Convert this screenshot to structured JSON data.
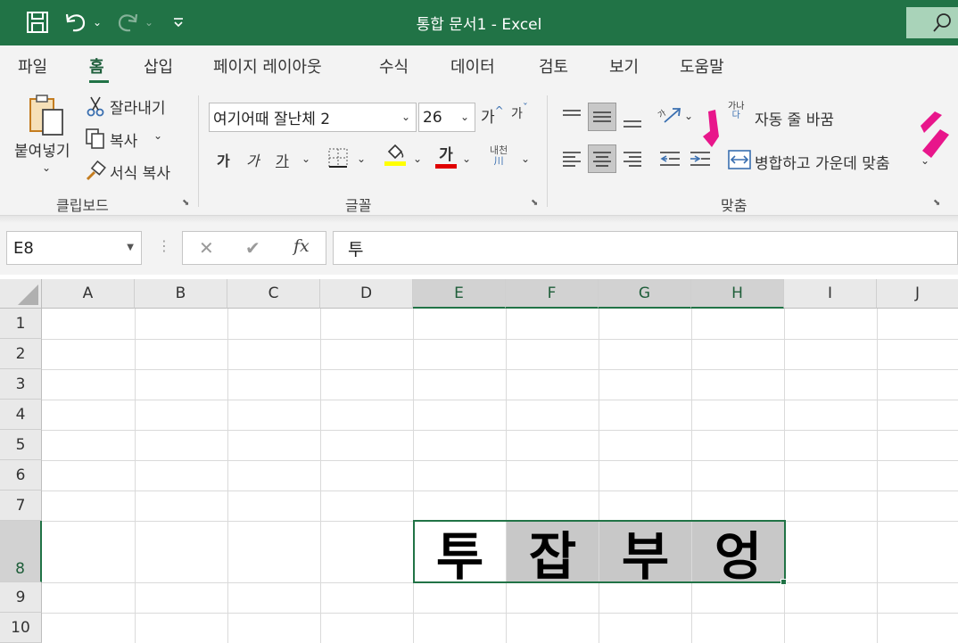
{
  "window": {
    "title": "통합 문서1  -  Excel"
  },
  "tabs": [
    "파일",
    "홈",
    "삽입",
    "페이지 레이아웃",
    "수식",
    "데이터",
    "검토",
    "보기",
    "도움말"
  ],
  "active_tab": "홈",
  "ribbon": {
    "clipboard": {
      "paste_label": "붙여넣기",
      "cut_label": "잘라내기",
      "copy_label": "복사",
      "format_painter_label": "서식 복사",
      "group_label": "클립보드"
    },
    "font": {
      "font_name": "여기어때 잘난체 2",
      "font_size": "26",
      "grow_label": "가",
      "shrink_label": "가",
      "bold_label": "가",
      "italic_label": "가",
      "underline_label": "가",
      "font_color_label": "가",
      "phonetic_top": "내천",
      "phonetic_bottom": "川",
      "group_label": "글꼴",
      "highlight_color": "#ffff00",
      "font_color": "#e00000"
    },
    "alignment": {
      "orientation_label": "가",
      "wrap_text_icon_top": "가나",
      "wrap_text_icon_bottom": "다",
      "wrap_text_label": "자동 줄 바꿈",
      "merge_center_label": "병합하고 가운데 맞춤",
      "group_label": "맞춤",
      "top_selected": "middle",
      "horizontal_selected": "center"
    }
  },
  "formula_bar": {
    "name_box": "E8",
    "cancel_icon": "✕",
    "enter_icon": "✔",
    "fx_label": "fx",
    "content": "투"
  },
  "sheet": {
    "columns": [
      "A",
      "B",
      "C",
      "D",
      "E",
      "F",
      "G",
      "H",
      "I",
      "J"
    ],
    "rows": [
      "1",
      "2",
      "3",
      "4",
      "5",
      "6",
      "7",
      "8",
      "9",
      "10"
    ],
    "selected_row": "8",
    "selected_columns": [
      "E",
      "F",
      "G",
      "H"
    ],
    "row8_cells": {
      "E8": "투",
      "F8": "잡",
      "G8": "부",
      "H8": "엉"
    }
  },
  "colors": {
    "excel_green": "#217346",
    "accent_pink": "#e8168b"
  }
}
